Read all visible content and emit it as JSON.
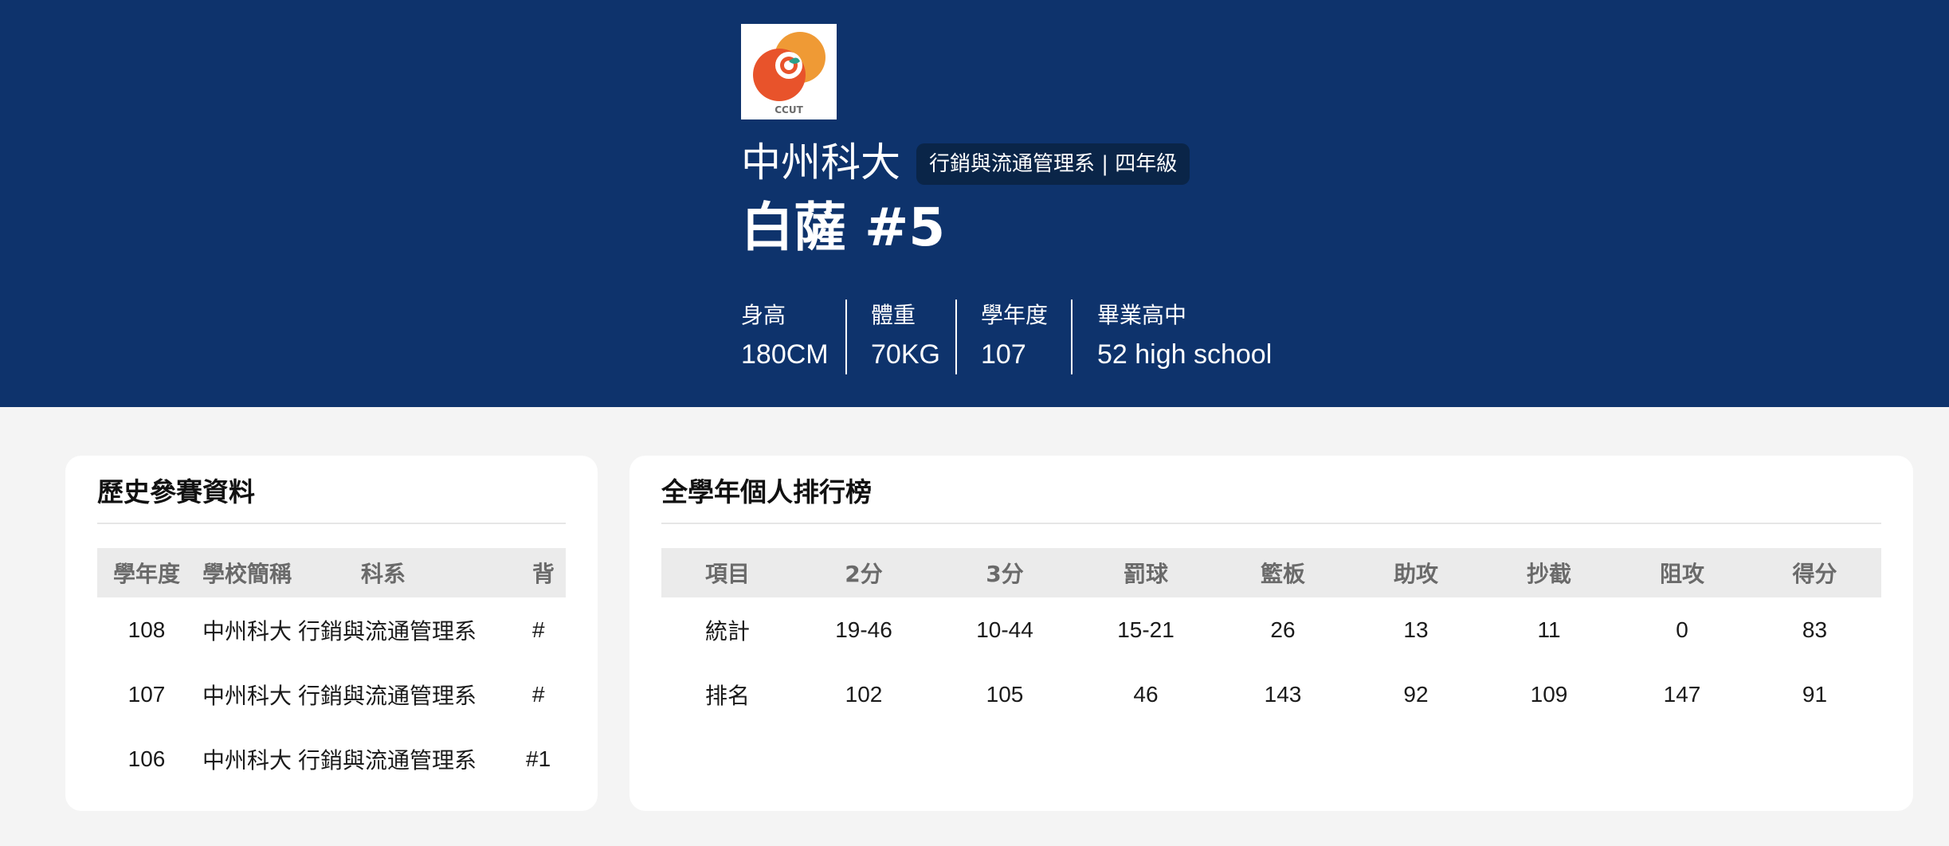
{
  "player": {
    "logo_text": "CCUT",
    "school": "中州科大",
    "dept_badge": "行銷與流通管理系 | 四年級",
    "name": "白薩 #5",
    "stats": [
      {
        "label": "身高",
        "value": "180CM"
      },
      {
        "label": "體重",
        "value": "70KG"
      },
      {
        "label": "學年度",
        "value": "107"
      },
      {
        "label": "畢業高中",
        "value": "52 high school"
      }
    ]
  },
  "history": {
    "title": "歷史參賽資料",
    "columns": [
      "學年度",
      "學校簡稱",
      "科系",
      "背"
    ],
    "rows": [
      {
        "year": "108",
        "school": "中州科大",
        "dept": "行銷與流通管理系",
        "number": "#"
      },
      {
        "year": "107",
        "school": "中州科大",
        "dept": "行銷與流通管理系",
        "number": "#"
      },
      {
        "year": "106",
        "school": "中州科大",
        "dept": "行銷與流通管理系",
        "number": "#1"
      }
    ]
  },
  "ranking": {
    "title": "全學年個人排行榜",
    "columns": [
      "項目",
      "2分",
      "3分",
      "罰球",
      "籃板",
      "助攻",
      "抄截",
      "阻攻",
      "得分"
    ],
    "rows": [
      {
        "label": "統計",
        "values": [
          "19-46",
          "10-44",
          "15-21",
          "26",
          "13",
          "11",
          "0",
          "83"
        ]
      },
      {
        "label": "排名",
        "values": [
          "102",
          "105",
          "46",
          "143",
          "92",
          "109",
          "147",
          "91"
        ]
      }
    ]
  },
  "colors": {
    "header_bg": "#0e336c",
    "badge_bg": "#0a2548",
    "page_bg": "#f4f4f4",
    "table_header_bg": "#ebebeb",
    "logo_orange": "#ef9a35",
    "logo_red_orange": "#e8532b",
    "logo_green": "#2aa08a"
  }
}
